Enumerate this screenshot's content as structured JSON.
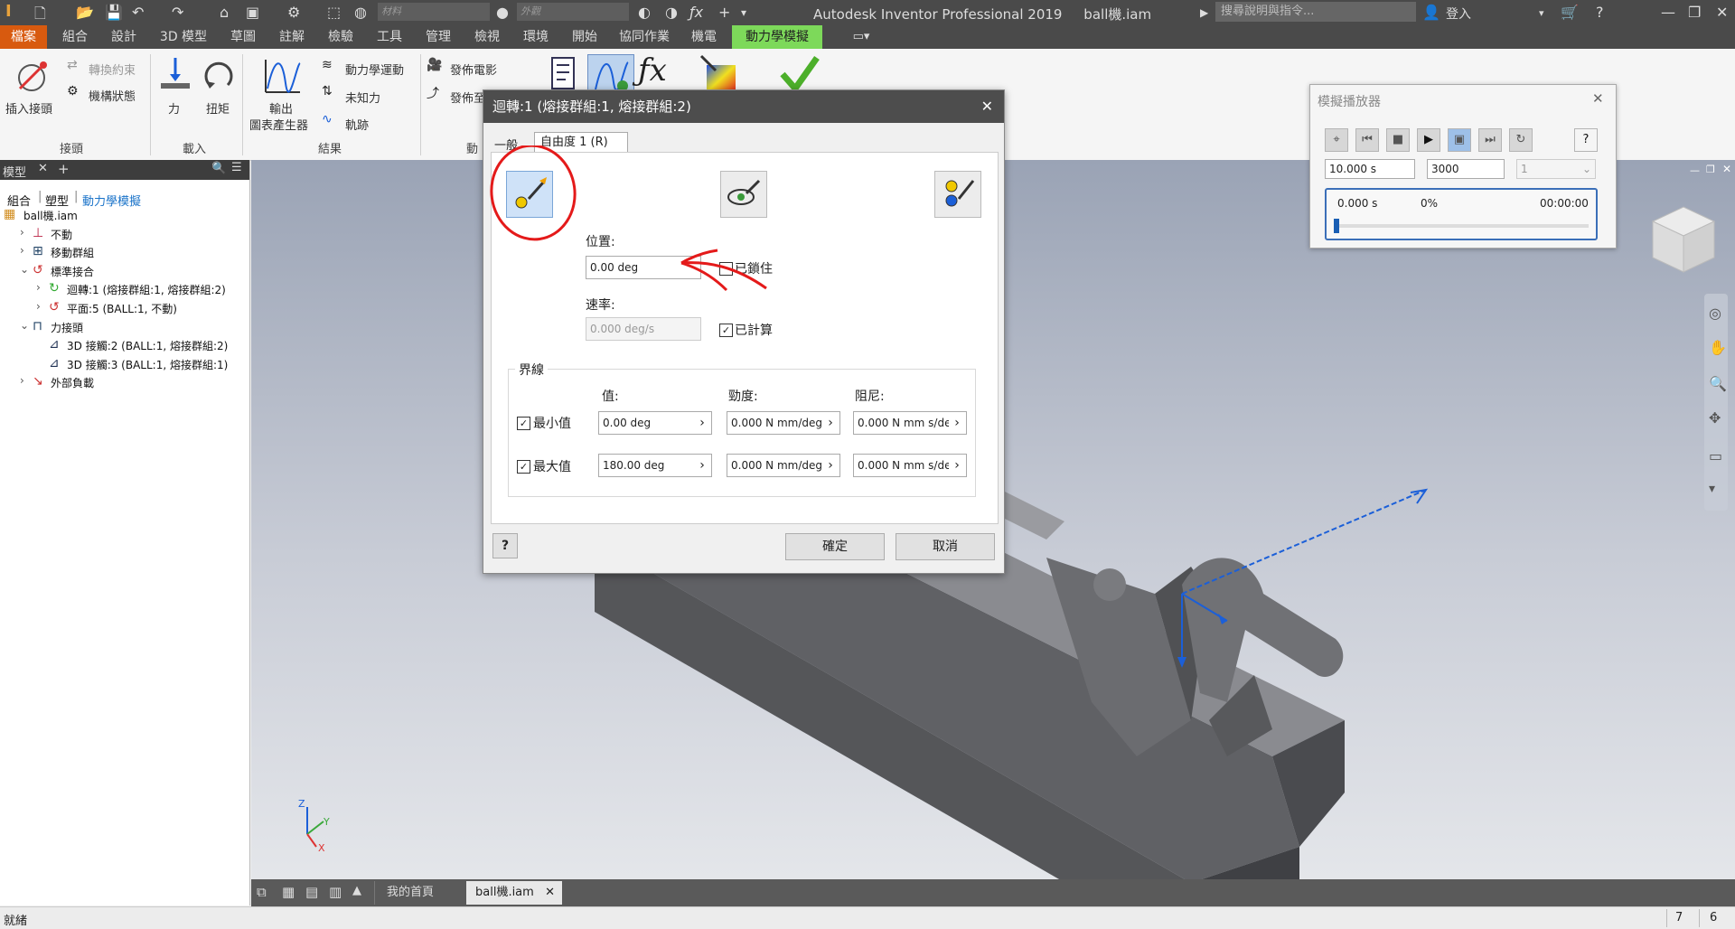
{
  "titlebar": {
    "app_title": "Autodesk Inventor Professional 2019     ball機.iam",
    "search_placeholder": "搜尋說明與指令...",
    "login": "登入",
    "material_combo": "材料",
    "appearance_combo": "外觀"
  },
  "menubar": {
    "tabs": [
      "檔案",
      "組合",
      "設計",
      "3D 模型",
      "草圖",
      "註解",
      "檢驗",
      "工具",
      "管理",
      "檢視",
      "環境",
      "開始",
      "協同作業",
      "機電",
      "動力學模擬"
    ],
    "active": "動力學模擬"
  },
  "ribbon": {
    "insert_joint": "插入接頭",
    "convert_constraint": "轉換約束",
    "mechanism_status": "機構狀態",
    "force": "力",
    "torque": "扭矩",
    "output_grapher_line1": "輸出",
    "output_grapher_line2": "圖表產生器",
    "dynamic_motion": "動力學運動",
    "unknown_force": "未知力",
    "trace": "軌跡",
    "publish_movie": "發佈電影",
    "publish_to": "發佈至",
    "group_joints": "接頭",
    "group_loads": "載入",
    "group_results": "結果",
    "group_anim": "動"
  },
  "browser": {
    "title": "模型",
    "tabs": [
      "組合",
      "塑型",
      "動力學模擬"
    ],
    "items": [
      {
        "label": "ball機.iam",
        "indent": 0
      },
      {
        "label": "不動",
        "indent": 1
      },
      {
        "label": "移動群組",
        "indent": 1
      },
      {
        "label": "標準接合",
        "indent": 1
      },
      {
        "label": "迴轉:1 (熔接群組:1, 熔接群組:2)",
        "indent": 2
      },
      {
        "label": "平面:5 (BALL:1, 不動)",
        "indent": 2
      },
      {
        "label": "力接頭",
        "indent": 1
      },
      {
        "label": "3D 接觸:2 (BALL:1, 熔接群組:2)",
        "indent": 2
      },
      {
        "label": "3D 接觸:3 (BALL:1, 熔接群組:1)",
        "indent": 2
      },
      {
        "label": "外部負載",
        "indent": 1
      }
    ]
  },
  "dialog": {
    "title": "迴轉:1 (熔接群組:1, 熔接群組:2)",
    "tab_general": "一般",
    "tab_dof": "自由度 1 (R)",
    "position_label": "位置:",
    "position_value": "0.00 deg",
    "locked_label": "已鎖住",
    "velocity_label": "速率:",
    "velocity_value": "0.000 deg/s",
    "computed_label": "已計算",
    "bounds_label": "界線",
    "col_value": "值:",
    "col_stiffness": "勁度:",
    "col_damping": "阻尼:",
    "min_label": "最小值",
    "max_label": "最大值",
    "min_value": "0.00 deg",
    "max_value": "180.00 deg",
    "min_stiffness": "0.000 N mm/deg",
    "max_stiffness": "0.000 N mm/deg",
    "min_damping": "0.000 N mm s/de",
    "max_damping": "0.000 N mm s/de",
    "ok": "確定",
    "cancel": "取消"
  },
  "player": {
    "title": "模擬播放器",
    "end_time": "10.000 s",
    "images": "3000",
    "filter": "1",
    "current_time": "0.000 s",
    "percent": "0%",
    "elapsed": "00:00:00",
    "progress": 0
  },
  "docbar": {
    "home_tab": "我的首頁",
    "file_tab": "ball機.iam"
  },
  "status": {
    "text": "就緒",
    "count1": "7",
    "count2": "6"
  },
  "triad": {
    "x": "X",
    "y": "Y",
    "z": "Z"
  },
  "colors": {
    "file_tab": "#d85a0f",
    "active_tab": "#7dd95a",
    "annotation": "#e41a1a",
    "joint_axis": "#1b5fd8"
  }
}
